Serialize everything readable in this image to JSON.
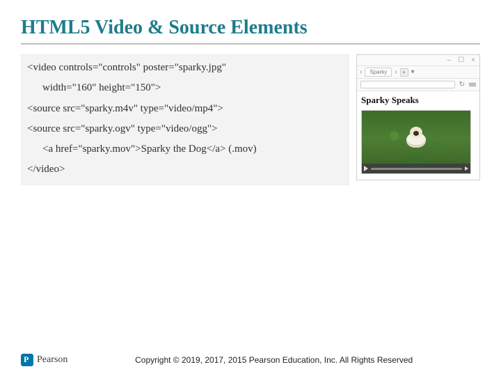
{
  "title": "HTML5 Video & Source Elements",
  "code": {
    "l1": "<video controls=\"controls\" poster=\"sparky.jpg\"",
    "l2": "width=\"160\" height=\"150\">",
    "l3": "<source src=\"sparky.m4v\" type=\"video/mp4\">",
    "l4": "<source src=\"sparky.ogv\" type=\"video/ogg\">",
    "l5": "<a href=\"sparky.mov\">Sparky the Dog</a> (.mov)",
    "l6": "</video>"
  },
  "browser": {
    "window": {
      "min": "–",
      "max": "☐",
      "close": "×"
    },
    "tab": "Sparky",
    "plus": "+",
    "dropdown": "▾",
    "reload": "↻",
    "page_title": "Sparky Speaks"
  },
  "footer": {
    "brand": "Pearson",
    "copyright": "Copyright © 2019, 2017, 2015 Pearson Education, Inc. All Rights Reserved"
  }
}
